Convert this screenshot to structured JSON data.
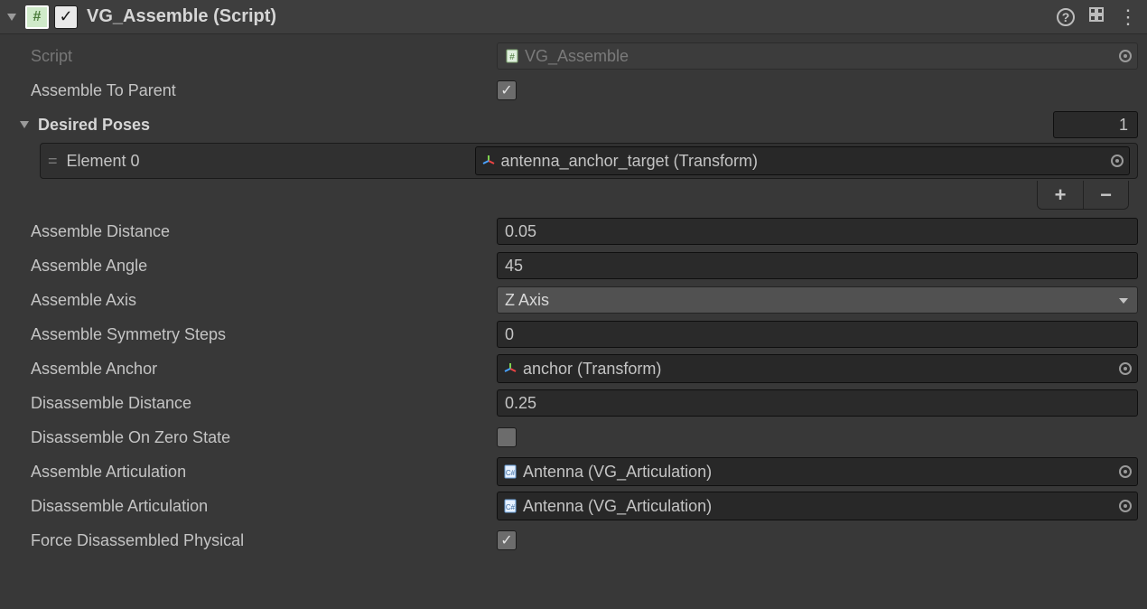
{
  "header": {
    "title": "VG_Assemble (Script)"
  },
  "fields": {
    "script_label": "Script",
    "script_value": "VG_Assemble",
    "assemble_to_parent_label": "Assemble To Parent",
    "assemble_to_parent_checked": true,
    "desired_poses_label": "Desired Poses",
    "desired_poses_count": "1",
    "element0_label": "Element 0",
    "element0_value": "antenna_anchor_target (Transform)",
    "assemble_distance_label": "Assemble Distance",
    "assemble_distance_value": "0.05",
    "assemble_angle_label": "Assemble Angle",
    "assemble_angle_value": "45",
    "assemble_axis_label": "Assemble Axis",
    "assemble_axis_value": "Z Axis",
    "assemble_symmetry_label": "Assemble Symmetry Steps",
    "assemble_symmetry_value": "0",
    "assemble_anchor_label": "Assemble Anchor",
    "assemble_anchor_value": "anchor (Transform)",
    "disassemble_distance_label": "Disassemble Distance",
    "disassemble_distance_value": "0.25",
    "disassemble_zero_label": "Disassemble On Zero State",
    "disassemble_zero_checked": false,
    "assemble_articulation_label": "Assemble Articulation",
    "assemble_articulation_value": "Antenna (VG_Articulation)",
    "disassemble_articulation_label": "Disassemble Articulation",
    "disassemble_articulation_value": "Antenna (VG_Articulation)",
    "force_disassembled_label": "Force Disassembled Physical",
    "force_disassembled_checked": true
  }
}
